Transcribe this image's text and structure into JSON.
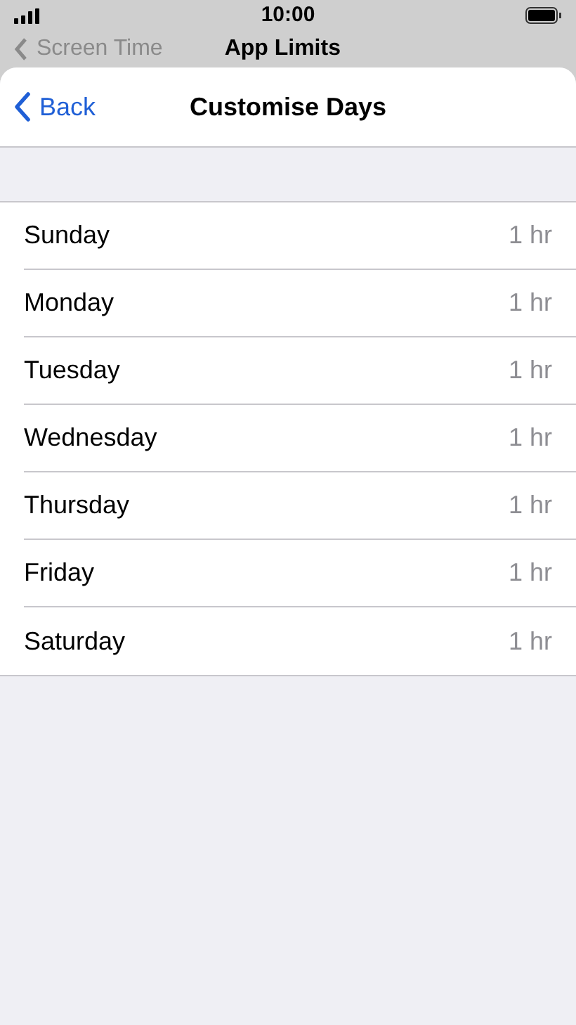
{
  "status_bar": {
    "time": "10:00"
  },
  "background_nav": {
    "back": "Screen Time",
    "title": "App Limits"
  },
  "nav": {
    "back": "Back",
    "title": "Customise Days"
  },
  "days": [
    {
      "day": "Sunday",
      "value": "1 hr"
    },
    {
      "day": "Monday",
      "value": "1 hr"
    },
    {
      "day": "Tuesday",
      "value": "1 hr"
    },
    {
      "day": "Wednesday",
      "value": "1 hr"
    },
    {
      "day": "Thursday",
      "value": "1 hr"
    },
    {
      "day": "Friday",
      "value": "1 hr"
    },
    {
      "day": "Saturday",
      "value": "1 hr"
    }
  ]
}
